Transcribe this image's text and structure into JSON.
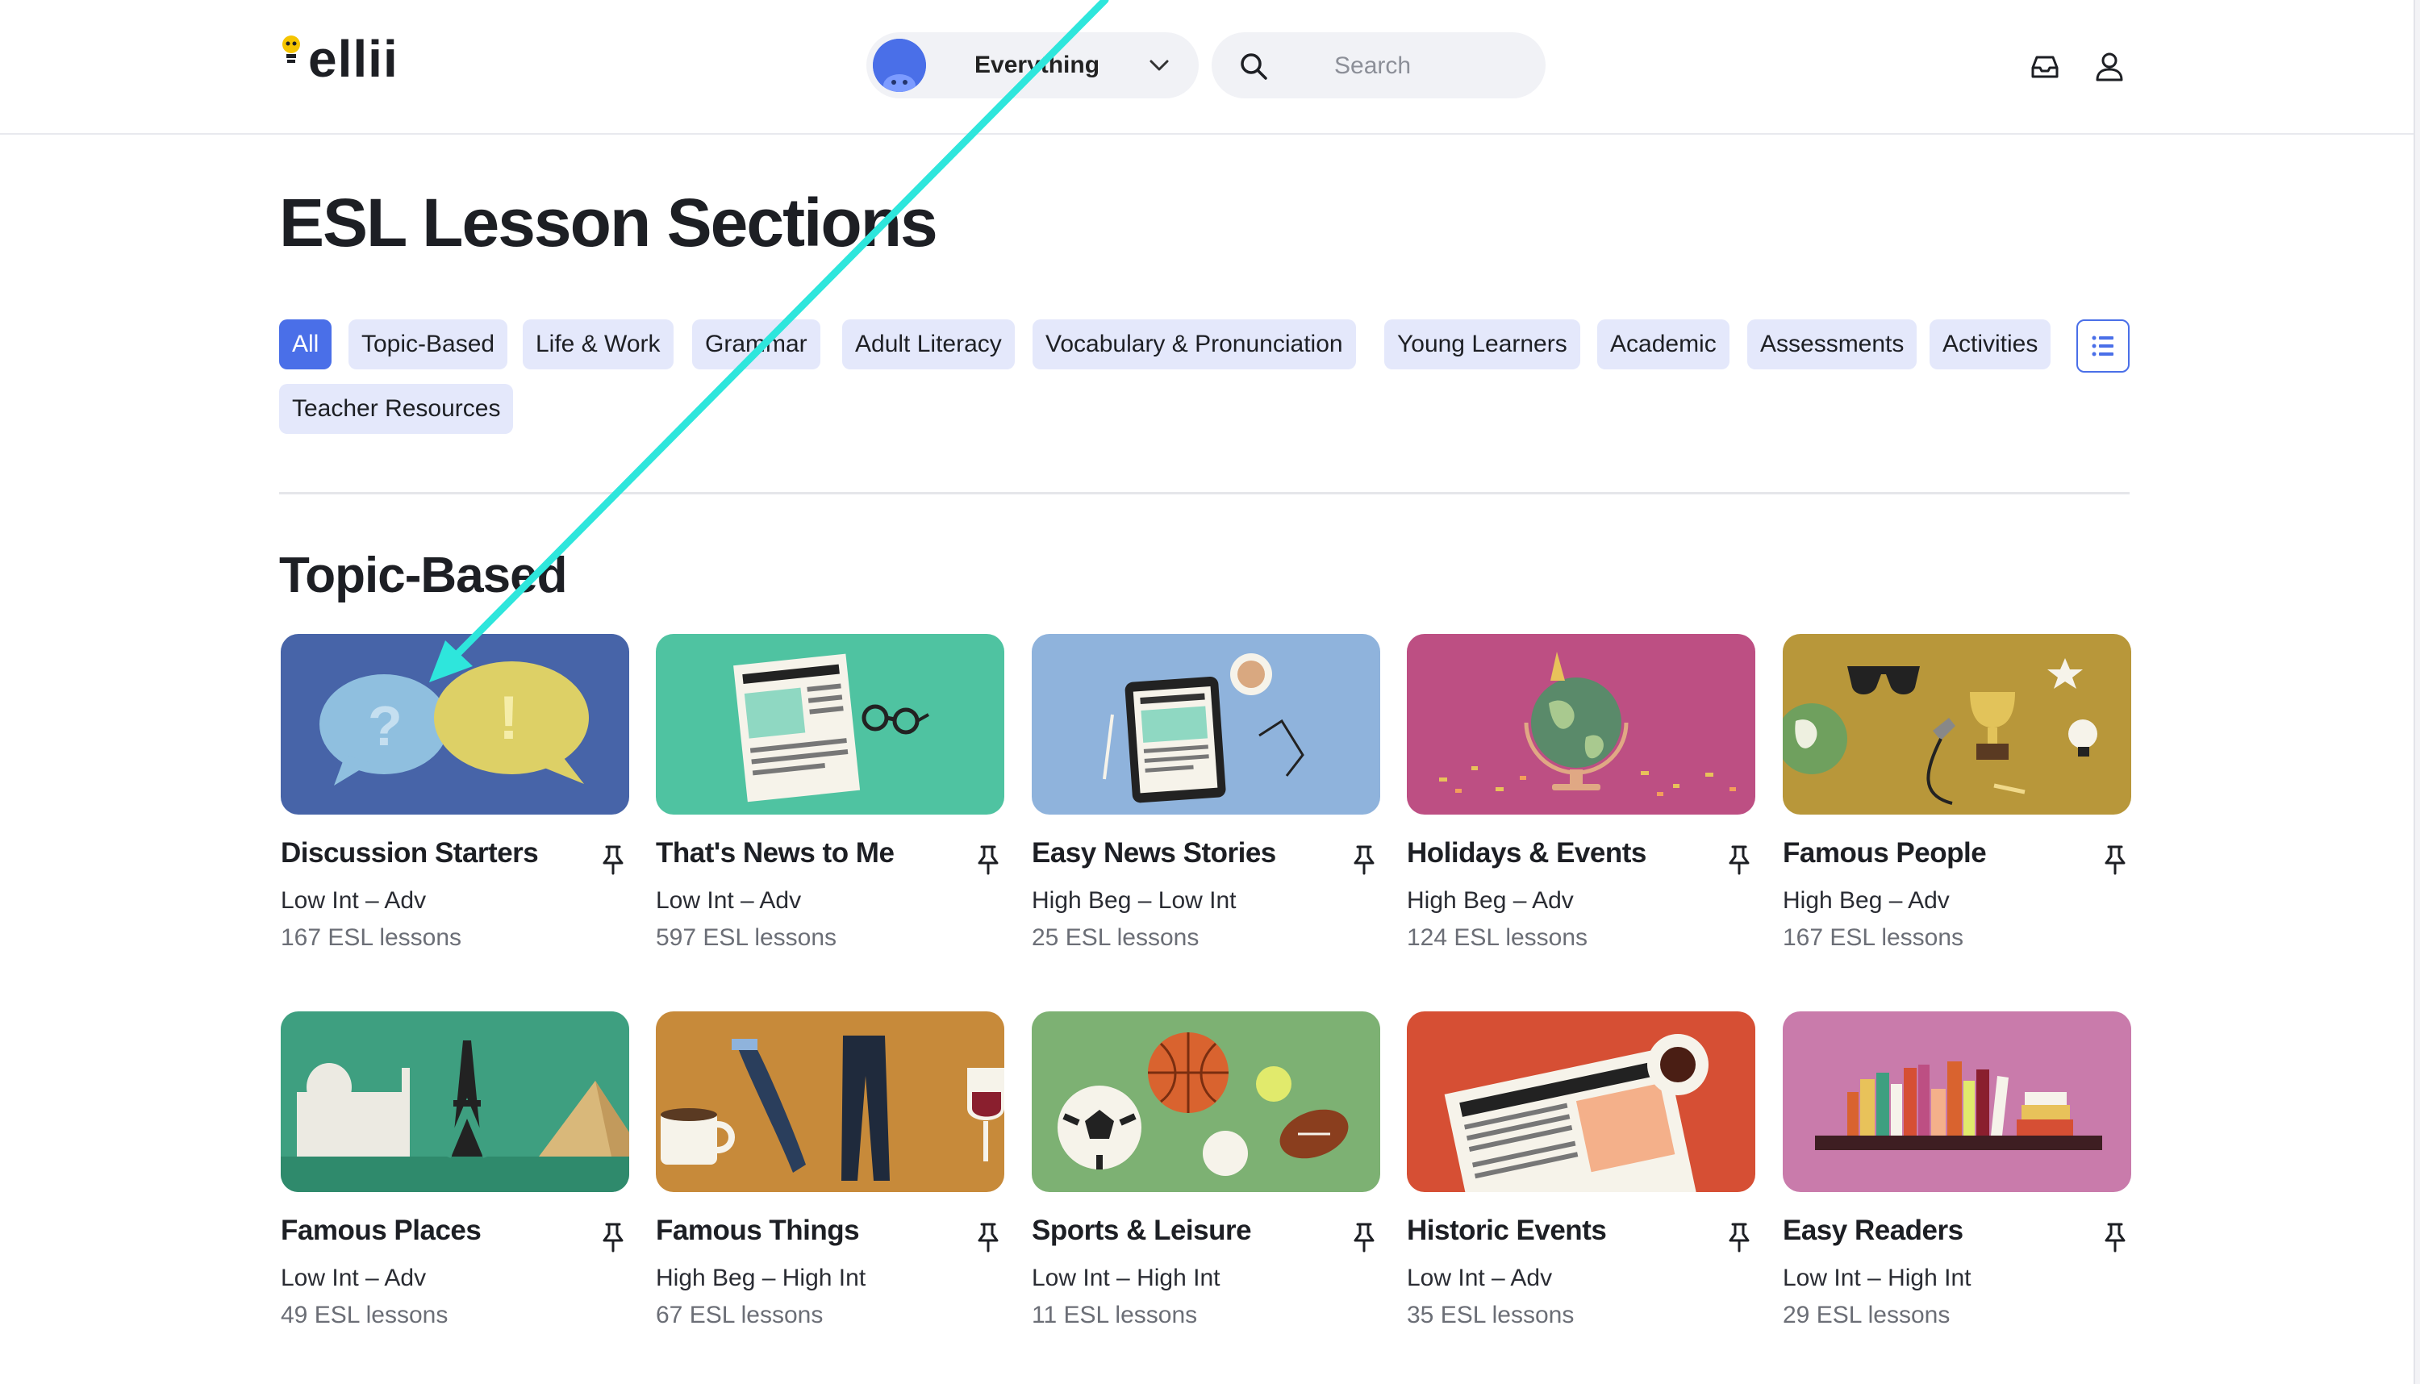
{
  "header": {
    "logo_text": "ellii",
    "scope_label": "Everything",
    "search_placeholder": "Search"
  },
  "page": {
    "title": "ESL Lesson Sections"
  },
  "filters": [
    {
      "label": "All",
      "active": true
    },
    {
      "label": "Topic-Based"
    },
    {
      "label": "Life & Work"
    },
    {
      "label": "Grammar"
    },
    {
      "label": "Adult Literacy"
    },
    {
      "label": "Vocabulary & Pronunciation"
    },
    {
      "label": "Young Learners"
    },
    {
      "label": "Academic"
    },
    {
      "label": "Assessments"
    },
    {
      "label": "Activities"
    },
    {
      "label": "Teacher Resources"
    }
  ],
  "section": {
    "title": "Topic-Based",
    "cards": [
      {
        "title": "Discussion Starters",
        "level": "Low Int – Adv",
        "count": "167 ESL lessons",
        "color": "#4764a8"
      },
      {
        "title": "That's News to Me",
        "level": "Low Int – Adv",
        "count": "597 ESL lessons",
        "color": "#4fc3a1"
      },
      {
        "title": "Easy News Stories",
        "level": "High Beg – Low Int",
        "count": "25 ESL lessons",
        "color": "#8fb3dc"
      },
      {
        "title": "Holidays & Events",
        "level": "High Beg – Adv",
        "count": "124 ESL lessons",
        "color": "#bd4f83"
      },
      {
        "title": "Famous People",
        "level": "High Beg – Adv",
        "count": "167 ESL lessons",
        "color": "#b8973a"
      },
      {
        "title": "Famous Places",
        "level": "Low Int – Adv",
        "count": "49 ESL lessons",
        "color": "#3e9f80"
      },
      {
        "title": "Famous Things",
        "level": "High Beg – High Int",
        "count": "67 ESL lessons",
        "color": "#c78a3a"
      },
      {
        "title": "Sports & Leisure",
        "level": "Low Int – High Int",
        "count": "11 ESL lessons",
        "color": "#7db173"
      },
      {
        "title": "Historic Events",
        "level": "Low Int – Adv",
        "count": "35 ESL lessons",
        "color": "#d64f34"
      },
      {
        "title": "Easy Readers",
        "level": "Low Int – High Int",
        "count": "29 ESL lessons",
        "color": "#c97bab"
      }
    ]
  },
  "colors": {
    "accent": "#4a6fe8",
    "chip_bg": "#e4e8fb",
    "annotation_arrow": "#2ee6dc"
  },
  "icons": {
    "scope": "chevron-down-icon",
    "search": "search-icon",
    "inbox": "inbox-icon",
    "account": "user-icon",
    "pin": "pin-icon",
    "list_view": "list-view-icon"
  }
}
